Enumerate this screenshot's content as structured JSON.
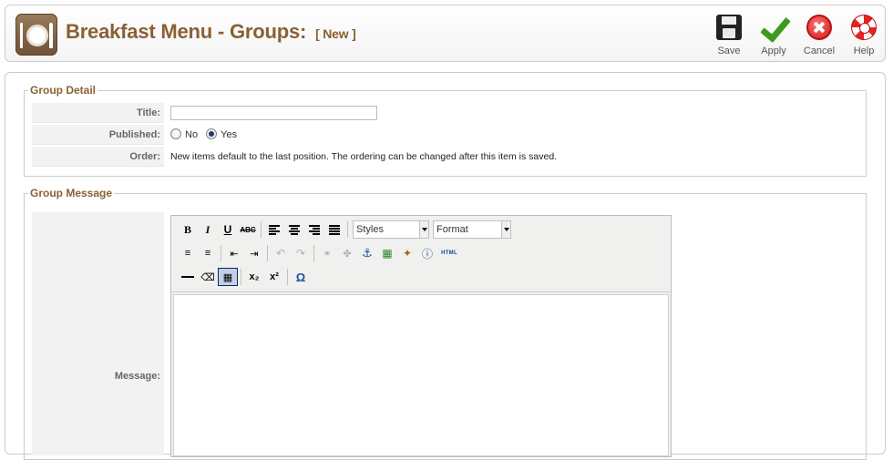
{
  "header": {
    "title": "Breakfast Menu - Groups:",
    "subtitle": "[ New ]",
    "buttons": [
      {
        "label": "Save",
        "icon": "save-icon"
      },
      {
        "label": "Apply",
        "icon": "apply-icon"
      },
      {
        "label": "Cancel",
        "icon": "cancel-icon"
      },
      {
        "label": "Help",
        "icon": "help-icon"
      }
    ]
  },
  "group_detail": {
    "legend": "Group Detail",
    "title_label": "Title:",
    "title_value": "",
    "published_label": "Published:",
    "published_options": [
      "No",
      "Yes"
    ],
    "published_selected": "Yes",
    "order_label": "Order:",
    "order_text": "New items default to the last position. The ordering can be changed after this item is saved."
  },
  "group_message": {
    "legend": "Group Message",
    "message_label": "Message:",
    "editor": {
      "styles_select": "Styles",
      "format_select": "Format",
      "html_button": "HTML"
    }
  }
}
